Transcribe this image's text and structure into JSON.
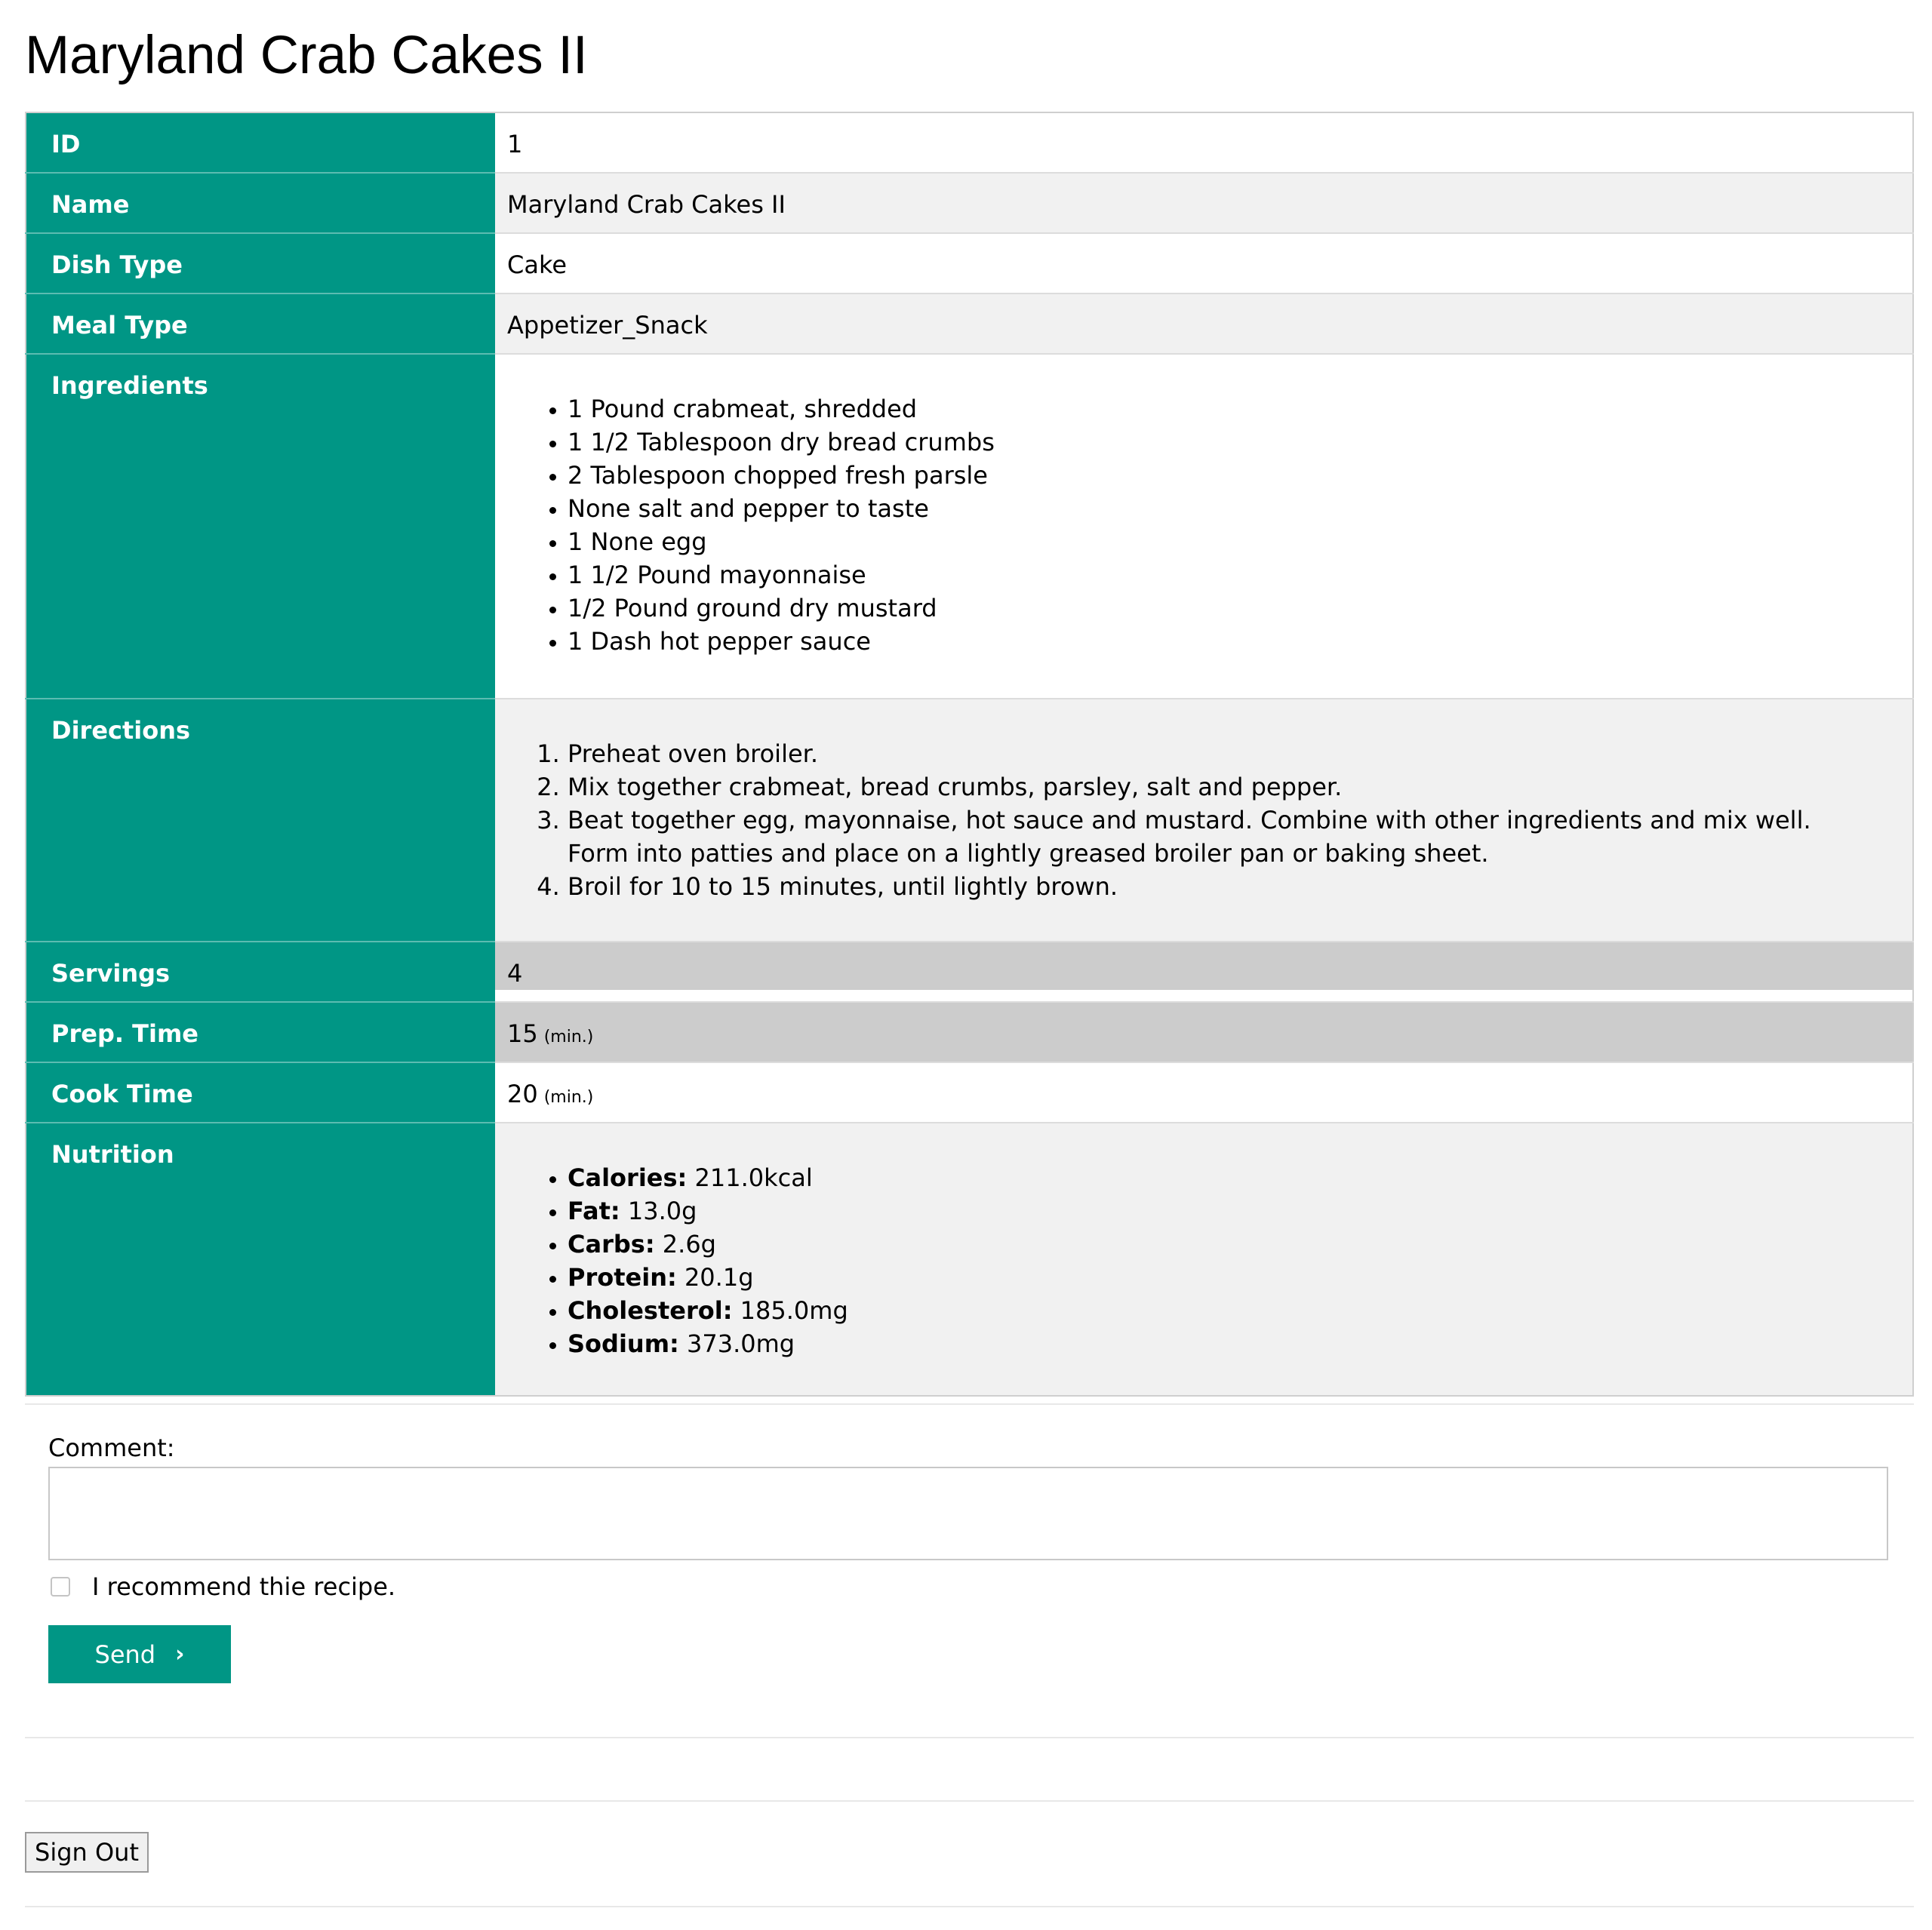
{
  "page": {
    "title": "Maryland Crab Cakes II"
  },
  "rows": {
    "id": {
      "label": "ID",
      "value": "1"
    },
    "name": {
      "label": "Name",
      "value": "Maryland Crab Cakes II"
    },
    "dish_type": {
      "label": "Dish Type",
      "value": "Cake"
    },
    "meal_type": {
      "label": "Meal Type",
      "value": "Appetizer_Snack"
    },
    "ingredients": {
      "label": "Ingredients",
      "items": [
        "1 Pound crabmeat, shredded",
        "1 1/2 Tablespoon dry bread crumbs",
        "2 Tablespoon chopped fresh parsle",
        "None salt and pepper to taste",
        "1 None egg",
        "1 1/2 Pound mayonnaise",
        "1/2 Pound ground dry mustard",
        "1 Dash hot pepper sauce"
      ]
    },
    "directions": {
      "label": "Directions",
      "steps": [
        "Preheat oven broiler.",
        "Mix together crabmeat, bread crumbs, parsley, salt and pepper.",
        "Beat together egg, mayonnaise, hot sauce and mustard. Combine with other ingredients and mix well. Form into patties and place on a lightly greased broiler pan or baking sheet.",
        "Broil for 10 to 15 minutes, until lightly brown."
      ]
    },
    "servings": {
      "label": "Servings",
      "value": "4"
    },
    "prep_time": {
      "label": "Prep. Time",
      "value": "15",
      "unit": "(min.)"
    },
    "cook_time": {
      "label": "Cook Time",
      "value": "20",
      "unit": "(min.)"
    },
    "nutrition": {
      "label": "Nutrition",
      "items": [
        {
          "name": "Calories:",
          "value": "211.0kcal"
        },
        {
          "name": "Fat:",
          "value": "13.0g"
        },
        {
          "name": "Carbs:",
          "value": "2.6g"
        },
        {
          "name": "Protein:",
          "value": "20.1g"
        },
        {
          "name": "Cholesterol:",
          "value": "185.0mg"
        },
        {
          "name": "Sodium:",
          "value": "373.0mg"
        }
      ]
    }
  },
  "form": {
    "comment_label": "Comment:",
    "comment_value": "",
    "recommend_label": "I recommend thie recipe.",
    "recommend_checked": false,
    "send_label": "Send",
    "send_icon": "chevron-right-icon"
  },
  "signout_label": "Sign Out",
  "colors": {
    "accent": "#009685",
    "row_grey": "#f1f1f1",
    "row_highlight": "#cccccc"
  }
}
